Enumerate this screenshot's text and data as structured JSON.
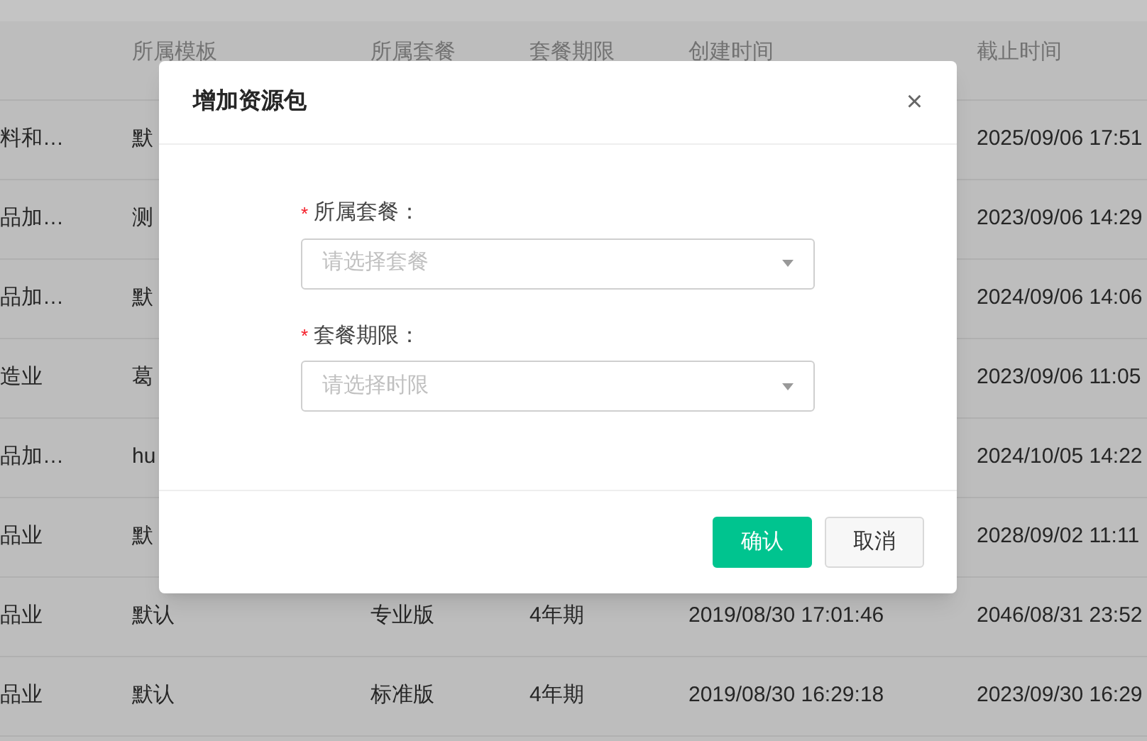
{
  "table": {
    "columns": [
      "",
      "所属模板",
      "所属套餐",
      "套餐期限",
      "创建时间",
      "截止时间"
    ],
    "rows": [
      {
        "cells": [
          "料和…",
          "默",
          "",
          "",
          "",
          "2025/09/06 17:51"
        ]
      },
      {
        "cells": [
          "品加…",
          "测",
          "",
          "",
          "",
          "2023/09/06 14:29"
        ]
      },
      {
        "cells": [
          "品加…",
          "默",
          "",
          "",
          "",
          "2024/09/06 14:06"
        ]
      },
      {
        "cells": [
          "造业",
          "葛",
          "",
          "",
          "",
          "2023/09/06 11:05"
        ]
      },
      {
        "cells": [
          "品加…",
          "hu",
          "",
          "",
          "",
          "2024/10/05 14:22"
        ]
      },
      {
        "cells": [
          "品业",
          "默",
          "",
          "",
          "",
          "2028/09/02 11:11"
        ]
      },
      {
        "cells": [
          "品业",
          "默认",
          "专业版",
          "4年期",
          "2019/08/30 17:01:46",
          "2046/08/31 23:52"
        ]
      },
      {
        "cells": [
          "品业",
          "默认",
          "标准版",
          "4年期",
          "2019/08/30 16:29:18",
          "2023/09/30 16:29"
        ]
      }
    ]
  },
  "dialog": {
    "title": "增加资源包",
    "close": "×",
    "fields": [
      {
        "required": "*",
        "label": "所属套餐：",
        "placeholder": "请选择套餐"
      },
      {
        "required": "*",
        "label": "套餐期限：",
        "placeholder": "请选择时限"
      }
    ],
    "buttons": [
      {
        "label": "确认",
        "kind": "primary"
      },
      {
        "label": "取消",
        "kind": "default"
      }
    ]
  }
}
